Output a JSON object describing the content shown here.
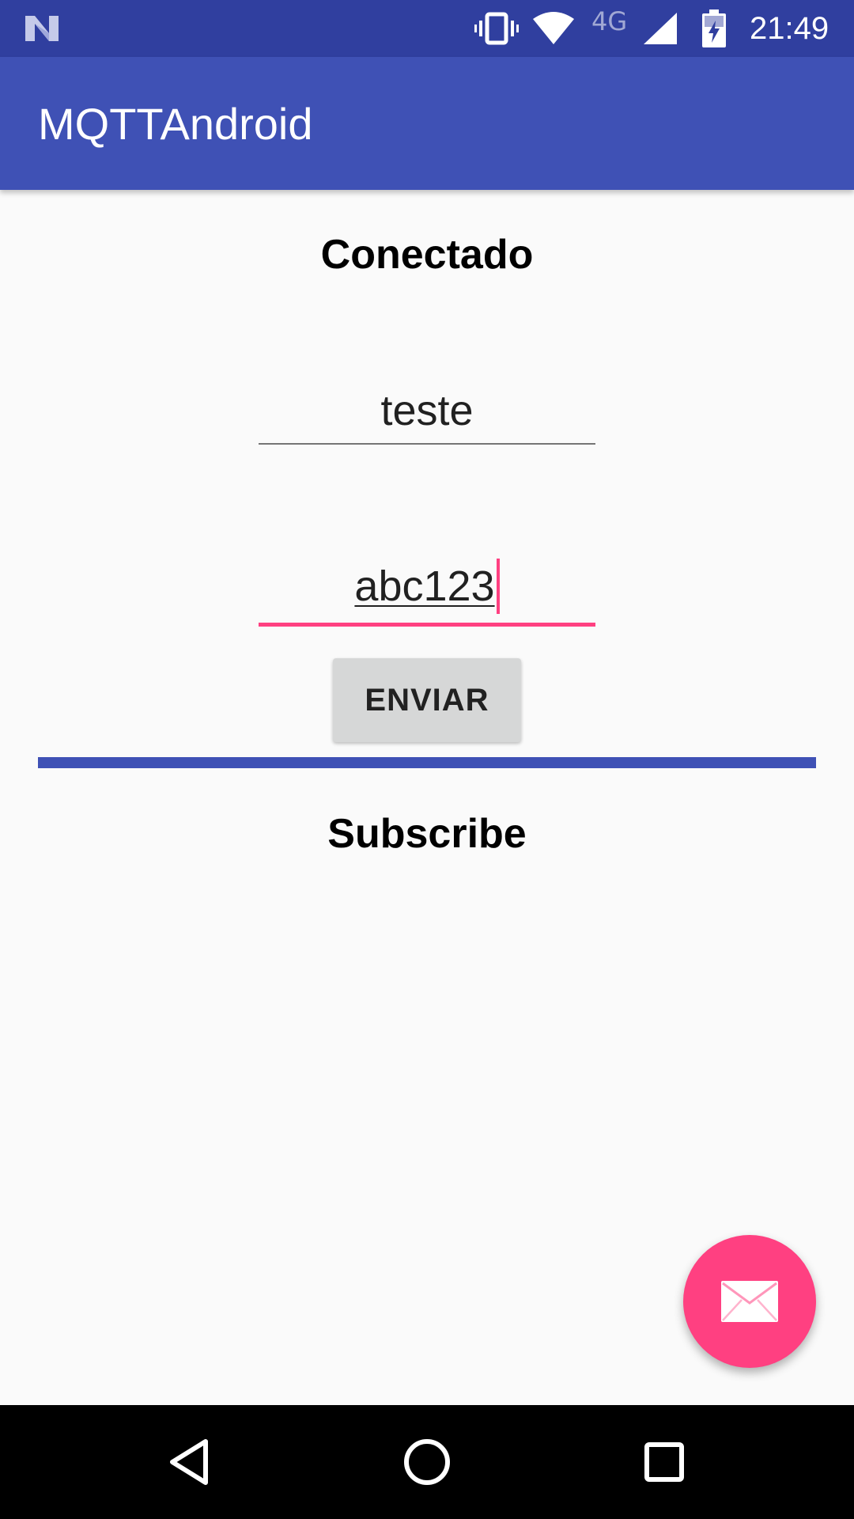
{
  "status_bar": {
    "network_type": "4G",
    "time": "21:49",
    "icons": [
      "n-logo-icon",
      "vibrate-icon",
      "wifi-icon",
      "signal-icon",
      "battery-charging-icon"
    ]
  },
  "app_bar": {
    "title": "MQTTAndroid"
  },
  "main": {
    "connection_status": "Conectado",
    "topic_field": {
      "value": "teste"
    },
    "message_field": {
      "value": "abc123",
      "focused": true
    },
    "send_button": {
      "label": "ENVIAR"
    },
    "subscribe_heading": "Subscribe"
  },
  "fab": {
    "icon": "mail-icon"
  },
  "nav_bar": {
    "buttons": [
      "back-icon",
      "home-icon",
      "recents-icon"
    ]
  },
  "colors": {
    "status_bar": "#303f9f",
    "primary": "#3f51b5",
    "accent": "#ff4081",
    "background": "#fafafa",
    "button": "#d6d7d7"
  }
}
